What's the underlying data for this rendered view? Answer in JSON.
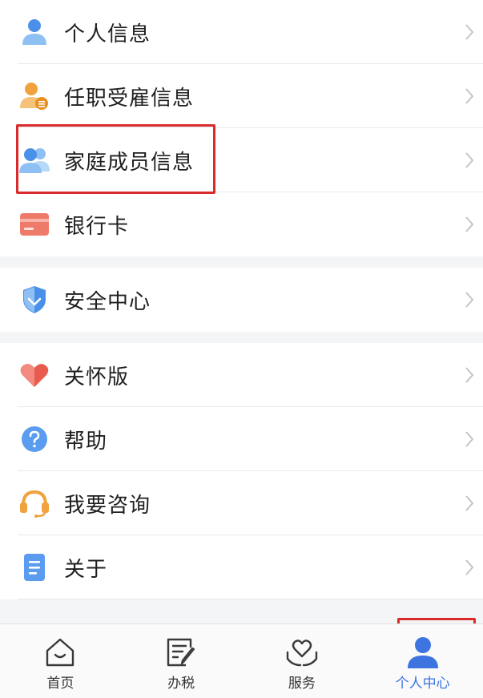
{
  "sections": [
    {
      "items": [
        {
          "label": "个人信息",
          "icon": "person-icon"
        },
        {
          "label": "任职受雇信息",
          "icon": "employee-icon"
        },
        {
          "label": "家庭成员信息",
          "icon": "family-icon"
        },
        {
          "label": "银行卡",
          "icon": "bank-card-icon"
        }
      ]
    },
    {
      "items": [
        {
          "label": "安全中心",
          "icon": "shield-icon"
        }
      ]
    },
    {
      "items": [
        {
          "label": "关怀版",
          "icon": "heart-icon"
        },
        {
          "label": "帮助",
          "icon": "question-icon"
        },
        {
          "label": "我要咨询",
          "icon": "headset-icon"
        },
        {
          "label": "关于",
          "icon": "document-icon"
        }
      ]
    }
  ],
  "tabbar": {
    "tabs": [
      {
        "label": "首页",
        "icon": "home-icon"
      },
      {
        "label": "办税",
        "icon": "tax-form-icon"
      },
      {
        "label": "服务",
        "icon": "service-heart-hands-icon"
      },
      {
        "label": "个人中心",
        "icon": "user-icon"
      }
    ],
    "active": "个人中心"
  },
  "colors": {
    "accent_blue": "#3d74e0",
    "highlight_red": "#d92b2b",
    "chevron": "#c4c4c4",
    "background": "#f4f5f7"
  }
}
